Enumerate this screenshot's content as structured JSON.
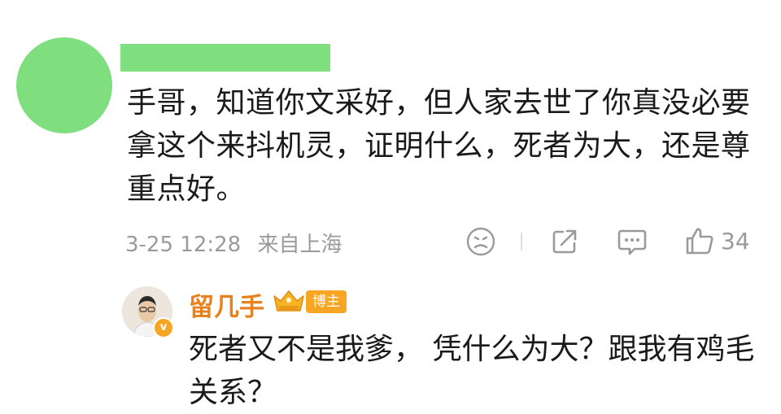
{
  "comment": {
    "text": "手哥，知道你文采好，但人家去世了你真没必要拿这个来抖机灵，证明什么，死者为大，还是尊重点好。",
    "date": "3-25 12:28",
    "location": "来自上海",
    "like_count": "34"
  },
  "reply": {
    "author": "留几手",
    "badge": "博主",
    "verify_mark": "v",
    "text": "死者又不是我爹， 凭什么为大？跟我有鸡毛关系？"
  },
  "colors": {
    "redaction": "#7fdf7f",
    "author_name": "#e8821e",
    "badge_bg": "#f6a623",
    "meta_gray": "#9a9a9a"
  },
  "icons": [
    "face-icon",
    "share-icon",
    "comment-icon",
    "like-icon",
    "crown-icon"
  ]
}
